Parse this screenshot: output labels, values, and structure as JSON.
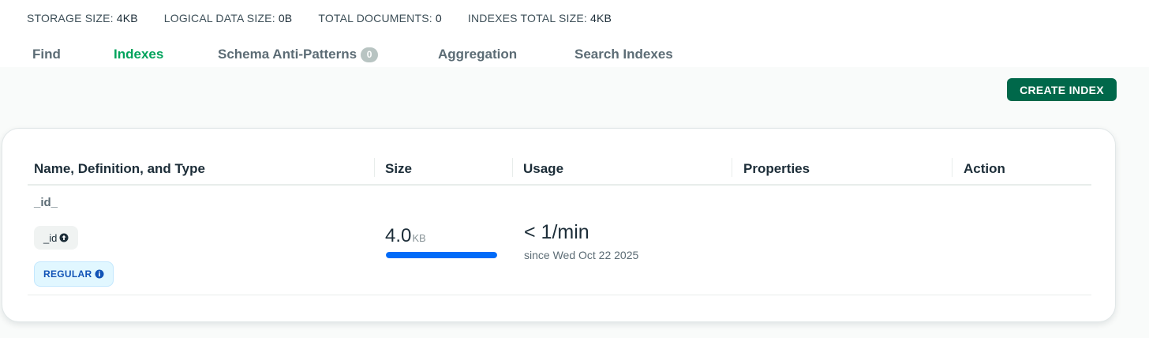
{
  "stats": [
    {
      "label": "STORAGE SIZE:",
      "value": "4KB"
    },
    {
      "label": "LOGICAL DATA SIZE:",
      "value": "0B"
    },
    {
      "label": "TOTAL DOCUMENTS:",
      "value": "0"
    },
    {
      "label": "INDEXES TOTAL SIZE:",
      "value": "4KB"
    }
  ],
  "tabs": [
    {
      "label": "Find",
      "active": false
    },
    {
      "label": "Indexes",
      "active": true
    },
    {
      "label": "Schema Anti-Patterns",
      "count": "0",
      "active": false
    },
    {
      "label": "Aggregation",
      "active": false
    },
    {
      "label": "Search Indexes",
      "active": false
    }
  ],
  "toolbar": {
    "create_index_label": "CREATE INDEX"
  },
  "table": {
    "headers": [
      "Name, Definition, and Type",
      "Size",
      "Usage",
      "Properties",
      "Action"
    ],
    "rows": [
      {
        "name": "_id_",
        "field": "_id",
        "field_icon": "arrow-up-circle-icon",
        "type": "REGULAR",
        "type_icon": "info-icon",
        "size_value": "4.0",
        "size_unit": "KB",
        "size_fraction": 1.0,
        "usage": "< 1/min",
        "usage_since": "since Wed Oct 22 2025",
        "properties": "",
        "action": ""
      }
    ]
  },
  "colors": {
    "accent_green": "#00a35c",
    "button_green": "#00684a",
    "size_bar_blue": "#016bf8",
    "badge_blue": "#1254b7"
  }
}
